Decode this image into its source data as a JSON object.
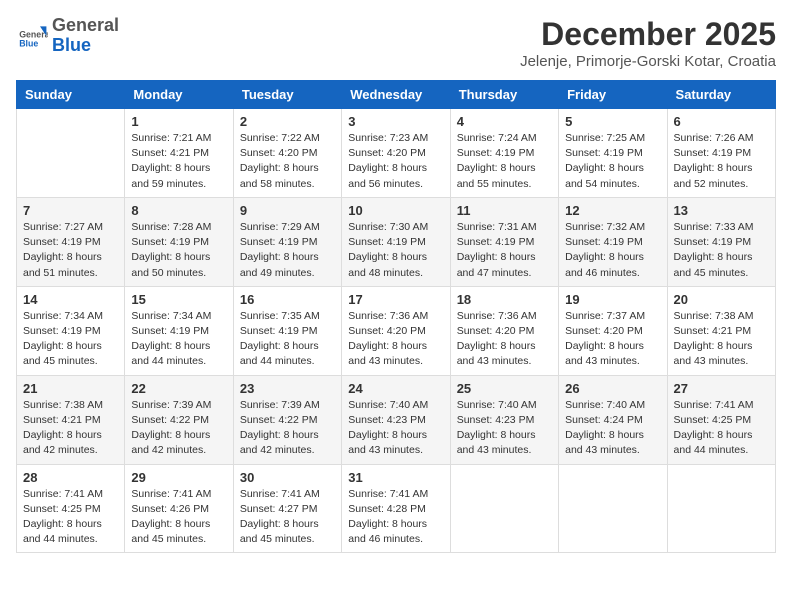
{
  "header": {
    "logo": {
      "general": "General",
      "blue": "Blue"
    },
    "month_year": "December 2025",
    "location": "Jelenje, Primorje-Gorski Kotar, Croatia"
  },
  "days_of_week": [
    "Sunday",
    "Monday",
    "Tuesday",
    "Wednesday",
    "Thursday",
    "Friday",
    "Saturday"
  ],
  "weeks": [
    [
      {
        "day": "",
        "info": ""
      },
      {
        "day": "1",
        "info": "Sunrise: 7:21 AM\nSunset: 4:21 PM\nDaylight: 8 hours\nand 59 minutes."
      },
      {
        "day": "2",
        "info": "Sunrise: 7:22 AM\nSunset: 4:20 PM\nDaylight: 8 hours\nand 58 minutes."
      },
      {
        "day": "3",
        "info": "Sunrise: 7:23 AM\nSunset: 4:20 PM\nDaylight: 8 hours\nand 56 minutes."
      },
      {
        "day": "4",
        "info": "Sunrise: 7:24 AM\nSunset: 4:19 PM\nDaylight: 8 hours\nand 55 minutes."
      },
      {
        "day": "5",
        "info": "Sunrise: 7:25 AM\nSunset: 4:19 PM\nDaylight: 8 hours\nand 54 minutes."
      },
      {
        "day": "6",
        "info": "Sunrise: 7:26 AM\nSunset: 4:19 PM\nDaylight: 8 hours\nand 52 minutes."
      }
    ],
    [
      {
        "day": "7",
        "info": "Sunrise: 7:27 AM\nSunset: 4:19 PM\nDaylight: 8 hours\nand 51 minutes."
      },
      {
        "day": "8",
        "info": "Sunrise: 7:28 AM\nSunset: 4:19 PM\nDaylight: 8 hours\nand 50 minutes."
      },
      {
        "day": "9",
        "info": "Sunrise: 7:29 AM\nSunset: 4:19 PM\nDaylight: 8 hours\nand 49 minutes."
      },
      {
        "day": "10",
        "info": "Sunrise: 7:30 AM\nSunset: 4:19 PM\nDaylight: 8 hours\nand 48 minutes."
      },
      {
        "day": "11",
        "info": "Sunrise: 7:31 AM\nSunset: 4:19 PM\nDaylight: 8 hours\nand 47 minutes."
      },
      {
        "day": "12",
        "info": "Sunrise: 7:32 AM\nSunset: 4:19 PM\nDaylight: 8 hours\nand 46 minutes."
      },
      {
        "day": "13",
        "info": "Sunrise: 7:33 AM\nSunset: 4:19 PM\nDaylight: 8 hours\nand 45 minutes."
      }
    ],
    [
      {
        "day": "14",
        "info": "Sunrise: 7:34 AM\nSunset: 4:19 PM\nDaylight: 8 hours\nand 45 minutes."
      },
      {
        "day": "15",
        "info": "Sunrise: 7:34 AM\nSunset: 4:19 PM\nDaylight: 8 hours\nand 44 minutes."
      },
      {
        "day": "16",
        "info": "Sunrise: 7:35 AM\nSunset: 4:19 PM\nDaylight: 8 hours\nand 44 minutes."
      },
      {
        "day": "17",
        "info": "Sunrise: 7:36 AM\nSunset: 4:20 PM\nDaylight: 8 hours\nand 43 minutes."
      },
      {
        "day": "18",
        "info": "Sunrise: 7:36 AM\nSunset: 4:20 PM\nDaylight: 8 hours\nand 43 minutes."
      },
      {
        "day": "19",
        "info": "Sunrise: 7:37 AM\nSunset: 4:20 PM\nDaylight: 8 hours\nand 43 minutes."
      },
      {
        "day": "20",
        "info": "Sunrise: 7:38 AM\nSunset: 4:21 PM\nDaylight: 8 hours\nand 43 minutes."
      }
    ],
    [
      {
        "day": "21",
        "info": "Sunrise: 7:38 AM\nSunset: 4:21 PM\nDaylight: 8 hours\nand 42 minutes."
      },
      {
        "day": "22",
        "info": "Sunrise: 7:39 AM\nSunset: 4:22 PM\nDaylight: 8 hours\nand 42 minutes."
      },
      {
        "day": "23",
        "info": "Sunrise: 7:39 AM\nSunset: 4:22 PM\nDaylight: 8 hours\nand 42 minutes."
      },
      {
        "day": "24",
        "info": "Sunrise: 7:40 AM\nSunset: 4:23 PM\nDaylight: 8 hours\nand 43 minutes."
      },
      {
        "day": "25",
        "info": "Sunrise: 7:40 AM\nSunset: 4:23 PM\nDaylight: 8 hours\nand 43 minutes."
      },
      {
        "day": "26",
        "info": "Sunrise: 7:40 AM\nSunset: 4:24 PM\nDaylight: 8 hours\nand 43 minutes."
      },
      {
        "day": "27",
        "info": "Sunrise: 7:41 AM\nSunset: 4:25 PM\nDaylight: 8 hours\nand 44 minutes."
      }
    ],
    [
      {
        "day": "28",
        "info": "Sunrise: 7:41 AM\nSunset: 4:25 PM\nDaylight: 8 hours\nand 44 minutes."
      },
      {
        "day": "29",
        "info": "Sunrise: 7:41 AM\nSunset: 4:26 PM\nDaylight: 8 hours\nand 45 minutes."
      },
      {
        "day": "30",
        "info": "Sunrise: 7:41 AM\nSunset: 4:27 PM\nDaylight: 8 hours\nand 45 minutes."
      },
      {
        "day": "31",
        "info": "Sunrise: 7:41 AM\nSunset: 4:28 PM\nDaylight: 8 hours\nand 46 minutes."
      },
      {
        "day": "",
        "info": ""
      },
      {
        "day": "",
        "info": ""
      },
      {
        "day": "",
        "info": ""
      }
    ]
  ]
}
